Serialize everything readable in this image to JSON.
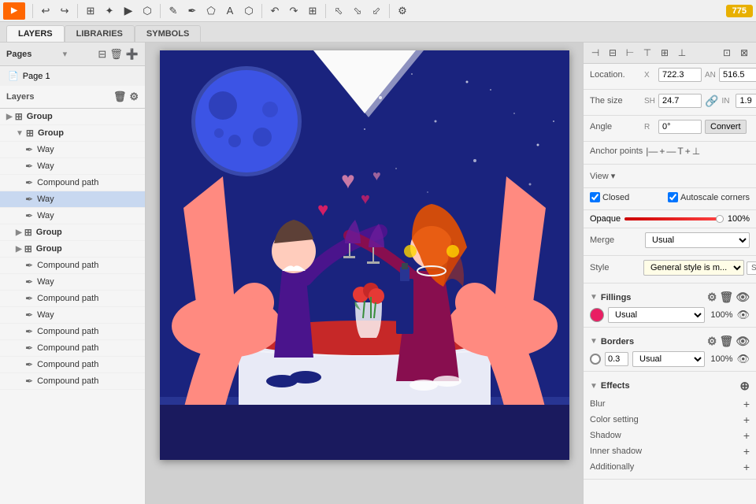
{
  "toolbar": {
    "logo": "▶",
    "buttons": [
      "↩",
      "↪",
      "⟲",
      "⊞",
      "✦",
      "▶",
      "⟨",
      "✎",
      "✒",
      "⬠",
      "✐",
      "A",
      "⬡",
      "⬢",
      "↶",
      "↷",
      "⊞",
      "⬤",
      "⬛",
      "⬁",
      "⬂",
      "⬃",
      "⬄",
      "⬅"
    ]
  },
  "tabs": {
    "layers": "LAYERS",
    "libraries": "LIBRARIES",
    "symbols": "SYMBOLS"
  },
  "pages": {
    "label": "Pages",
    "items": [
      {
        "label": "Page 1",
        "icon": "📄"
      }
    ]
  },
  "layers": {
    "label": "Layers",
    "items": [
      {
        "id": 1,
        "label": "Group",
        "type": "group",
        "indent": 0,
        "expanded": true
      },
      {
        "id": 2,
        "label": "Group",
        "type": "group",
        "indent": 1,
        "expanded": true
      },
      {
        "id": 3,
        "label": "Way",
        "type": "path",
        "indent": 2
      },
      {
        "id": 4,
        "label": "Way",
        "type": "path",
        "indent": 2
      },
      {
        "id": 5,
        "label": "Compound path",
        "type": "compound",
        "indent": 2
      },
      {
        "id": 6,
        "label": "Way",
        "type": "path",
        "indent": 2,
        "selected": true
      },
      {
        "id": 7,
        "label": "Way",
        "type": "path",
        "indent": 2
      },
      {
        "id": 8,
        "label": "Group",
        "type": "group",
        "indent": 1,
        "expanded": true
      },
      {
        "id": 9,
        "label": "Group",
        "type": "group",
        "indent": 1,
        "expanded": true
      },
      {
        "id": 10,
        "label": "Compound path",
        "type": "compound",
        "indent": 2
      },
      {
        "id": 11,
        "label": "Way",
        "type": "path",
        "indent": 2
      },
      {
        "id": 12,
        "label": "Compound path",
        "type": "compound",
        "indent": 2
      },
      {
        "id": 13,
        "label": "Way",
        "type": "path",
        "indent": 2
      },
      {
        "id": 14,
        "label": "Compound path",
        "type": "compound",
        "indent": 2
      },
      {
        "id": 15,
        "label": "Compound path",
        "type": "compound",
        "indent": 2
      },
      {
        "id": 16,
        "label": "Compound path",
        "type": "compound",
        "indent": 2
      },
      {
        "id": 17,
        "label": "Compound path",
        "type": "compound",
        "indent": 2
      }
    ]
  },
  "properties": {
    "location": {
      "label": "Location.",
      "x_prefix": "X",
      "x_value": "722.3",
      "an_prefix": "AN",
      "an_value": "516.5"
    },
    "size": {
      "label": "The size",
      "sh_prefix": "SH",
      "sh_value": "24.7",
      "in_prefix": "IN",
      "in_value": "1.9"
    },
    "angle": {
      "label": "Angle",
      "r_prefix": "R",
      "r_value": "0°",
      "convert_btn": "Convert"
    },
    "anchor_points": {
      "label": "Anchor points"
    },
    "view": {
      "label": "View ▾"
    },
    "closed": {
      "label": "Closed",
      "checked": true
    },
    "autoscale": {
      "label": "Autoscale corners",
      "checked": true
    },
    "opaque": {
      "label": "Opaque",
      "value": "100%"
    },
    "merge": {
      "label": "Merge",
      "value": "Usual"
    },
    "style": {
      "label": "Style",
      "value": "General style is m...",
      "sync": "Synchrono"
    },
    "fillings": {
      "label": "Fillings",
      "color": "#e91e63",
      "type": "Usual",
      "opacity": "100%"
    },
    "borders": {
      "label": "Borders",
      "width": "0.3",
      "type": "Usual",
      "opacity": "100%"
    },
    "effects": {
      "label": "Effects"
    },
    "blur": {
      "label": "Blur"
    },
    "color_setting": {
      "label": "Color setting"
    },
    "shadow": {
      "label": "Shadow"
    },
    "inner_shadow": {
      "label": "Inner shadow"
    },
    "additionally": {
      "label": "Additionally"
    }
  },
  "align_toolbar": {
    "icons": [
      "⊞",
      "⊟",
      "⊠",
      "⊡",
      "⊢",
      "⊣"
    ]
  }
}
